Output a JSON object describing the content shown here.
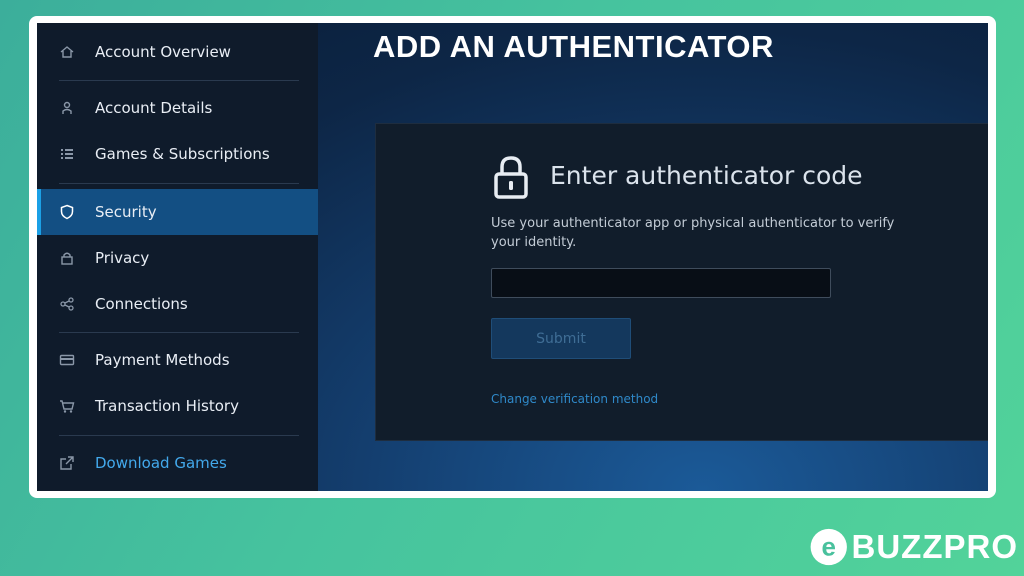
{
  "sidebar": {
    "items": [
      {
        "label": "Account Overview",
        "icon": "home-icon"
      },
      {
        "label": "Account Details",
        "icon": "user-icon"
      },
      {
        "label": "Games & Subscriptions",
        "icon": "list-icon"
      },
      {
        "label": "Security",
        "icon": "shield-icon",
        "active": true
      },
      {
        "label": "Privacy",
        "icon": "lock-icon"
      },
      {
        "label": "Connections",
        "icon": "share-icon"
      },
      {
        "label": "Payment Methods",
        "icon": "card-icon"
      },
      {
        "label": "Transaction History",
        "icon": "cart-icon"
      },
      {
        "label": "Download Games",
        "icon": "external-link-icon"
      }
    ]
  },
  "main": {
    "title": "ADD AN AUTHENTICATOR",
    "panel": {
      "heading": "Enter authenticator code",
      "description": "Use your authenticator app or physical authenticator to verify your identity.",
      "input_value": "",
      "submit_label": "Submit",
      "change_link": "Change verification method"
    }
  },
  "watermark": {
    "letter": "e",
    "text": "BUZZPRO"
  },
  "colors": {
    "accent": "#1ba0e6",
    "active_bg": "#134f83",
    "sidebar_bg": "#0f1b2b",
    "link": "#2f89c9",
    "background_gradient": "#3cae9b"
  }
}
